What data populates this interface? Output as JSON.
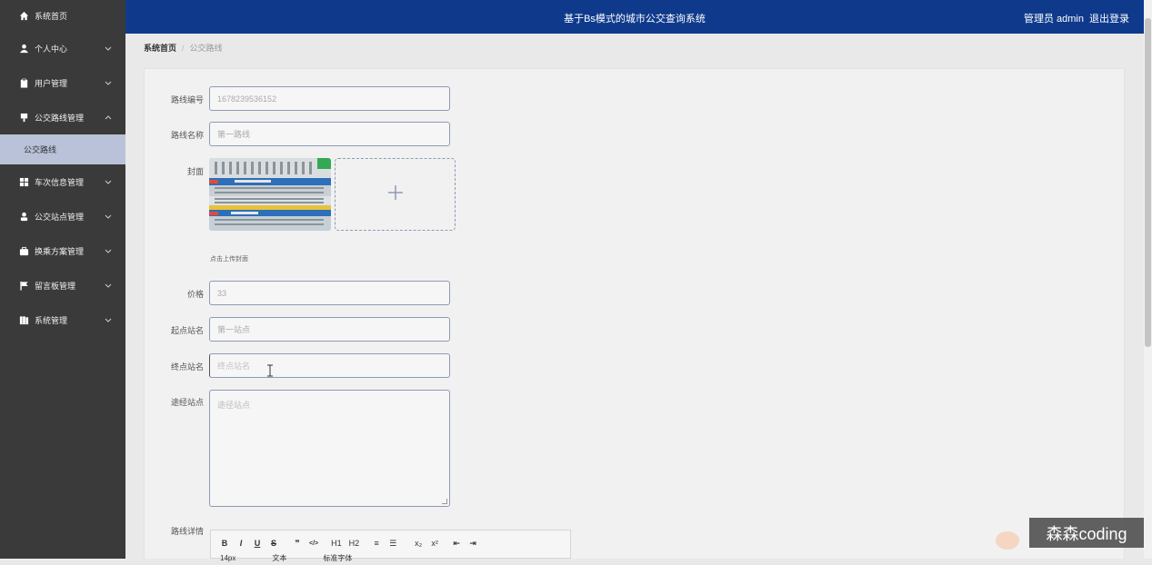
{
  "topbar": {
    "title": "基于Bs模式的城市公交查询系统",
    "user_label": "管理员 admin",
    "logout_label": "退出登录"
  },
  "sidebar": {
    "items": [
      {
        "label": "系统首页",
        "icon": "home-icon"
      },
      {
        "label": "个人中心",
        "icon": "user-icon"
      },
      {
        "label": "用户管理",
        "icon": "clipboard-icon"
      },
      {
        "label": "公交路线管理",
        "icon": "pin-icon"
      },
      {
        "label": "车次信息管理",
        "icon": "grid-icon"
      },
      {
        "label": "公交站点管理",
        "icon": "person-icon"
      },
      {
        "label": "换乘方案管理",
        "icon": "briefcase-icon"
      },
      {
        "label": "留言板管理",
        "icon": "flag-icon"
      },
      {
        "label": "系统管理",
        "icon": "book-icon"
      }
    ],
    "submenu": {
      "label": "公交路线"
    }
  },
  "breadcrumb": {
    "home": "系统首页",
    "current": "公交路线"
  },
  "form": {
    "route_no": {
      "label": "路线编号",
      "value": "1678239536152"
    },
    "route_name": {
      "label": "路线名称",
      "value": "第一路线"
    },
    "cover": {
      "label": "封面",
      "hint": "点击上传封面"
    },
    "price": {
      "label": "价格",
      "value": "33"
    },
    "start_station": {
      "label": "起点站名",
      "value": "第一站点"
    },
    "end_station": {
      "label": "终点站名",
      "placeholder": "终点站名"
    },
    "via_stations": {
      "label": "途经站点",
      "placeholder": "途径站点"
    },
    "details": {
      "label": "路线详情"
    }
  },
  "editor": {
    "row1": [
      "B",
      "I",
      "U",
      "S",
      "❞",
      "</>",
      "H1",
      "H2",
      "≡",
      "☰",
      "x₂",
      "x²",
      "⇤",
      "⇥"
    ],
    "font_size": "14px",
    "text_type": "文本",
    "font_family": "标准字体"
  },
  "watermark": "森森coding"
}
